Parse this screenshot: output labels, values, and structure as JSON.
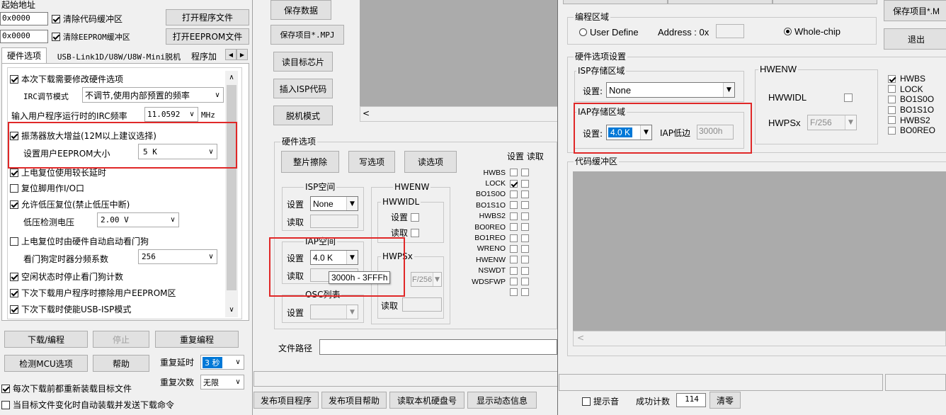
{
  "left": {
    "start_addr_label": "起始地址",
    "addr1": "0x0000",
    "clear_code_label": "清除代码缓冲区",
    "open_program": "打开程序文件",
    "addr2": "0x0000",
    "clear_eeprom_label": "清除EEPROM缓冲区",
    "open_eeprom": "打开EEPROM文件",
    "tabs": [
      "硬件选项",
      "USB-Link1D/U8W/U8W-Mini脱机",
      "程序加"
    ],
    "options": {
      "modify_hw": "本次下载需要修改硬件选项",
      "irc_mode_label": "IRC调节模式",
      "irc_mode_value": "不调节,使用内部预置的频率",
      "irc_freq_label": "输入用户程序运行时的IRC频率",
      "irc_freq_value": "11.0592",
      "irc_freq_unit": "MHz",
      "osc_gain": "振荡器放大增益(12M以上建议选择)",
      "eeprom_size_label": "设置用户EEPROM大小",
      "eeprom_size_value": "5   K",
      "power_delay": "上电复位使用较长延时",
      "reset_pin": "复位脚用作I/O口",
      "low_volt_reset": "允许低压复位(禁止低压中断)",
      "low_volt_label": "低压检测电压",
      "low_volt_value": "2.00 V",
      "wdt_auto": "上电复位时由硬件自动启动看门狗",
      "wdt_div_label": "看门狗定时器分频系数",
      "wdt_div_value": "256",
      "idle_wdt": "空闲状态时停止看门狗计数",
      "erase_eeprom": "下次下载用户程序时擦除用户EEPROM区",
      "usb_isp": "下次下载时使能USB-ISP模式"
    },
    "download": "下载/编程",
    "stop": "停止",
    "reprogram": "重复编程",
    "check_mcu": "检测MCU选项",
    "help": "帮助",
    "retry_delay_label": "重复延时",
    "retry_delay_value": "3 秒",
    "retry_count_label": "重复次数",
    "retry_count_value": "无限",
    "reload_each": "每次下载前都重新装载目标文件",
    "auto_send": "当目标文件变化时自动装载并发送下载命令"
  },
  "middle": {
    "save_data": "保存数据",
    "save_project": "保存项目*.MPJ",
    "read_target": "读目标芯片",
    "insert_isp": "插入ISP代码",
    "offline_mode": "脱机模式",
    "hw_opts_title": "硬件选项",
    "erase_chip": "整片擦除",
    "write_opts": "写选项",
    "read_opts": "读选项",
    "set_read_header": "设置 读取",
    "isp_space": "ISP空间",
    "isp_set_label": "设置",
    "isp_set_value": "None",
    "isp_read_label": "读取",
    "iap_space": "IAP空间",
    "iap_set_label": "设置",
    "iap_set_value": "4.0 K",
    "iap_read_label": "读取",
    "tooltip": "3000h - 3FFFh",
    "osc_list": "OSC列表",
    "osc_set_label": "设置",
    "hwenw_title": "HWENW",
    "hwwidl_title": "HWWIDL",
    "hwwidl_set": "设置",
    "hwwidl_read": "读取",
    "hwpsx_title": "HWPSx",
    "hwpsx_value": "F/256",
    "hwpsx_read": "读取",
    "flags": [
      "HWBS",
      "LOCK",
      "BO1S0O",
      "BO1S1O",
      "HWBS2",
      "BO0REO",
      "BO1REO",
      "WRENO",
      "HWENW",
      "NSWDT",
      "WDSFWP",
      ""
    ],
    "flag_checked_index": 1,
    "file_path_label": "文件路径"
  },
  "right": {
    "save_project": "保存项目*.M",
    "exit": "退出",
    "prog_area_title": "编程区域",
    "user_define": "User Define",
    "address_label": "Address : 0x",
    "whole_chip": "Whole-chip",
    "hw_settings_title": "硬件选项设置",
    "isp_area_title": "ISP存储区域",
    "isp_set_label": "设置:",
    "isp_set_value": "None",
    "iap_area_title": "IAP存储区域",
    "iap_set_label": "设置:",
    "iap_set_value": "4.0 K",
    "iap_low_label": "IAP低边",
    "iap_low_value": "3000h",
    "hwenw_title": "HWENW",
    "hwwidl_label": "HWWIDL",
    "hwpsx_label": "HWPSx",
    "hwpsx_value": "F/256",
    "flags": [
      "HWBS",
      "LOCK",
      "BO1S0O",
      "BO1S1O",
      "HWBS2",
      "BO0REO"
    ],
    "flag_checked_index": 0,
    "code_buffer_title": "代码缓冲区"
  },
  "footer": {
    "publish_program": "发布项目程序",
    "publish_help": "发布项目帮助",
    "read_disk": "读取本机硬盘号",
    "show_dynamic": "显示动态信息",
    "beep": "提示音",
    "success_label": "成功计数",
    "success_value": "114",
    "clear": "清零"
  }
}
